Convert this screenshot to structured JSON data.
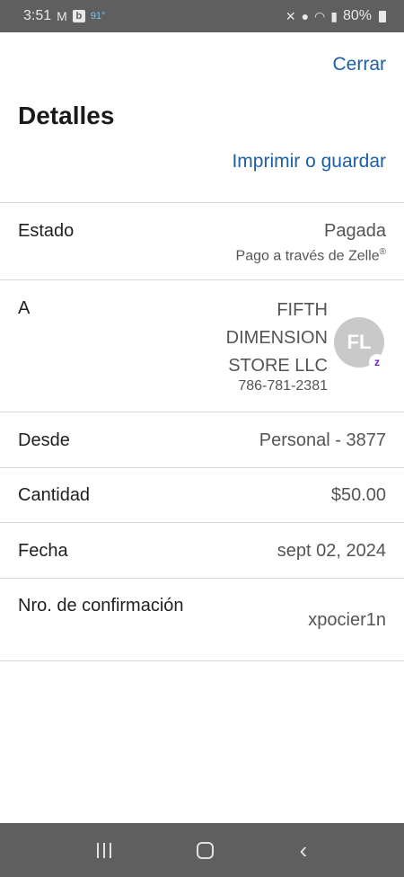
{
  "status_bar": {
    "time": "3:51",
    "mail_icon": "M",
    "app_badge": "b",
    "temperature": "91°",
    "battery": "80%"
  },
  "header": {
    "close_label": "Cerrar",
    "title": "Detalles",
    "print_label": "Imprimir o guardar"
  },
  "details": {
    "estado": {
      "label": "Estado",
      "value": "Pagada",
      "subtext": "Pago a través de Zelle",
      "subtext_mark": "®"
    },
    "a": {
      "label": "A",
      "name": "FIFTH DIMENSION STORE LLC",
      "phone": "786-781-2381",
      "avatar_initials": "FL",
      "badge": "z"
    },
    "desde": {
      "label": "Desde",
      "value": "Personal - 3877"
    },
    "cantidad": {
      "label": "Cantidad",
      "value": "$50.00"
    },
    "fecha": {
      "label": "Fecha",
      "value": "sept 02, 2024"
    },
    "confirmacion": {
      "label": "Nro. de confirmación",
      "value": "xpocier1n"
    }
  },
  "icons": {
    "wifi": "wifi-icon",
    "signal": "signal-icon",
    "location": "location-icon",
    "mute": "mute-icon",
    "nav_recent": "recent-apps-icon",
    "nav_home": "home-icon",
    "nav_back": "back-icon"
  }
}
